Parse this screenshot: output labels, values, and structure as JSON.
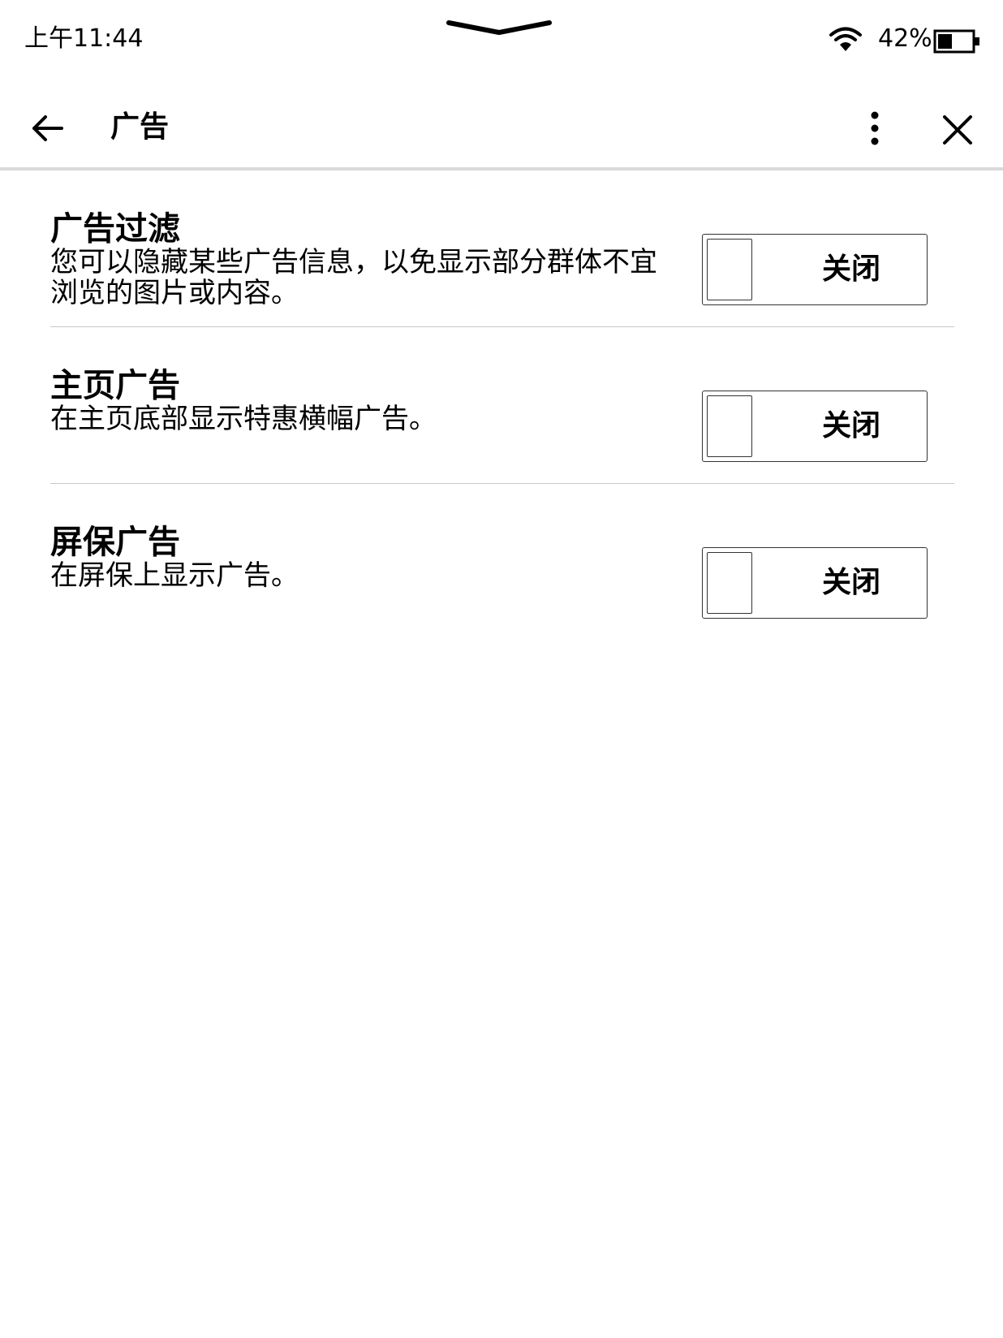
{
  "status_bar": {
    "time": "上午11:44",
    "battery_percent": "42%",
    "battery_level": 0.42,
    "wifi_icon": "wifi-icon",
    "battery_icon": "battery-icon"
  },
  "header": {
    "title": "广告",
    "back_icon": "arrow-left-icon",
    "more_icon": "more-vertical-icon",
    "close_icon": "close-icon"
  },
  "settings": [
    {
      "title": "广告过滤",
      "description": "您可以隐藏某些广告信息，以免显示部分群体不宜浏览的图片或内容。",
      "toggle_label": "关闭",
      "toggle_on": false
    },
    {
      "title": "主页广告",
      "description": "在主页底部显示特惠横幅广告。",
      "toggle_label": "关闭",
      "toggle_on": false
    },
    {
      "title": "屏保广告",
      "description": "在屏保上显示广告。",
      "toggle_label": "关闭",
      "toggle_on": false
    }
  ],
  "colors": {
    "background": "#ffffff",
    "text": "#000000",
    "divider": "#c8c8c8",
    "header_border": "#d9d9d9"
  }
}
